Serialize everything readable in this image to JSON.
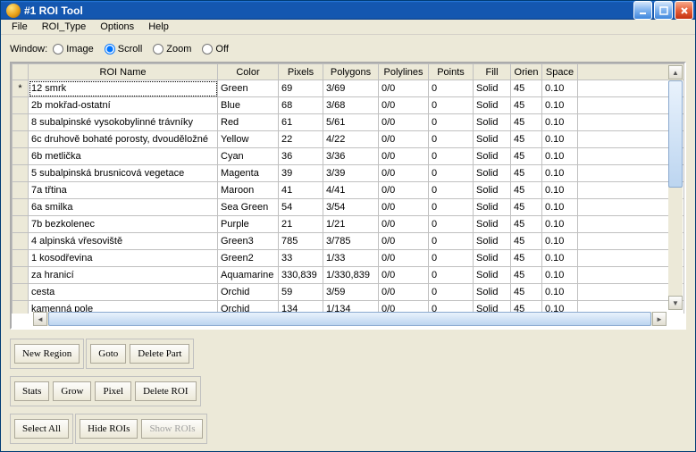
{
  "title": "#1 ROI Tool",
  "menu": {
    "file": "File",
    "roi_type": "ROI_Type",
    "options": "Options",
    "help": "Help"
  },
  "radios": {
    "label": "Window:",
    "image": "Image",
    "scroll": "Scroll",
    "zoom": "Zoom",
    "off": "Off"
  },
  "headers": {
    "name": "ROI Name",
    "color": "Color",
    "pixels": "Pixels",
    "polygons": "Polygons",
    "polylines": "Polylines",
    "points": "Points",
    "fill": "Fill",
    "orien": "Orien",
    "space": "Space"
  },
  "rows": [
    {
      "sel": "*",
      "name": "12 smrk",
      "color": "Green",
      "pixels": "69",
      "polygons": "3/69",
      "polylines": "0/0",
      "points": "0",
      "fill": "Solid",
      "orien": "45",
      "space": "0.10"
    },
    {
      "sel": "",
      "name": "2b mokřad-ostatní",
      "color": "Blue",
      "pixels": "68",
      "polygons": "3/68",
      "polylines": "0/0",
      "points": "0",
      "fill": "Solid",
      "orien": "45",
      "space": "0.10"
    },
    {
      "sel": "",
      "name": "8 subalpinské vysokobylinné trávníky",
      "color": "Red",
      "pixels": "61",
      "polygons": "5/61",
      "polylines": "0/0",
      "points": "0",
      "fill": "Solid",
      "orien": "45",
      "space": "0.10"
    },
    {
      "sel": "",
      "name": "6c druhově bohaté porosty, dvouděložné",
      "color": "Yellow",
      "pixels": "22",
      "polygons": "4/22",
      "polylines": "0/0",
      "points": "0",
      "fill": "Solid",
      "orien": "45",
      "space": "0.10"
    },
    {
      "sel": "",
      "name": "6b metlička",
      "color": "Cyan",
      "pixels": "36",
      "polygons": "3/36",
      "polylines": "0/0",
      "points": "0",
      "fill": "Solid",
      "orien": "45",
      "space": "0.10"
    },
    {
      "sel": "",
      "name": "5 subalpinská brusnicová vegetace",
      "color": "Magenta",
      "pixels": "39",
      "polygons": "3/39",
      "polylines": "0/0",
      "points": "0",
      "fill": "Solid",
      "orien": "45",
      "space": "0.10"
    },
    {
      "sel": "",
      "name": "7a třtina",
      "color": "Maroon",
      "pixels": "41",
      "polygons": "4/41",
      "polylines": "0/0",
      "points": "0",
      "fill": "Solid",
      "orien": "45",
      "space": "0.10"
    },
    {
      "sel": "",
      "name": "6a smilka",
      "color": "Sea Green",
      "pixels": "54",
      "polygons": "3/54",
      "polylines": "0/0",
      "points": "0",
      "fill": "Solid",
      "orien": "45",
      "space": "0.10"
    },
    {
      "sel": "",
      "name": "7b bezkolenec",
      "color": "Purple",
      "pixels": "21",
      "polygons": "1/21",
      "polylines": "0/0",
      "points": "0",
      "fill": "Solid",
      "orien": "45",
      "space": "0.10"
    },
    {
      "sel": "",
      "name": "4 alpinská vřesoviště",
      "color": "Green3",
      "pixels": "785",
      "polygons": "3/785",
      "polylines": "0/0",
      "points": "0",
      "fill": "Solid",
      "orien": "45",
      "space": "0.10"
    },
    {
      "sel": "",
      "name": "1 kosodřevina",
      "color": "Green2",
      "pixels": "33",
      "polygons": "1/33",
      "polylines": "0/0",
      "points": "0",
      "fill": "Solid",
      "orien": "45",
      "space": "0.10"
    },
    {
      "sel": "",
      "name": "za hranicí",
      "color": "Aquamarine",
      "pixels": "330,839",
      "polygons": "1/330,839",
      "polylines": "0/0",
      "points": "0",
      "fill": "Solid",
      "orien": "45",
      "space": "0.10"
    },
    {
      "sel": "",
      "name": "cesta",
      "color": "Orchid",
      "pixels": "59",
      "polygons": "3/59",
      "polylines": "0/0",
      "points": "0",
      "fill": "Solid",
      "orien": "45",
      "space": "0.10"
    },
    {
      "sel": "",
      "name": "kamenná pole",
      "color": "Orchid",
      "pixels": "134",
      "polygons": "1/134",
      "polylines": "0/0",
      "points": "0",
      "fill": "Solid",
      "orien": "45",
      "space": "0.10"
    }
  ],
  "buttons": {
    "new_region": "New Region",
    "goto": "Goto",
    "delete_part": "Delete Part",
    "stats": "Stats",
    "grow": "Grow",
    "pixel": "Pixel",
    "delete_roi": "Delete ROI",
    "select_all": "Select All",
    "hide_rois": "Hide ROIs",
    "show_rois": "Show ROIs"
  }
}
